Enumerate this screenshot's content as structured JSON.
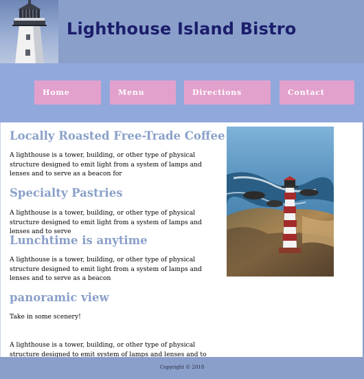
{
  "header": {
    "title": "Lighthouse Island Bistro",
    "logo_icon": "lighthouse-tower-icon"
  },
  "nav": {
    "items": [
      {
        "label": "Home"
      },
      {
        "label": "Menu"
      },
      {
        "label": "Directions"
      },
      {
        "label": "Contact"
      }
    ]
  },
  "main": {
    "sections": [
      {
        "heading": "Locally Roasted Free-Trade Coffee",
        "text": "A lighthouse is a tower, building, or other type of physical structure designed to emit light from a system of lamps and lenses and to serve as a beacon for"
      },
      {
        "heading": "Specialty Pastries",
        "text": "A lighthouse is a tower, building, or other type of physical structure designed to emit light from a system of lamps and lenses and to serve"
      },
      {
        "heading": "Lunchtime is anytime",
        "text": "A lighthouse is a tower, building, or other type of physical structure designed to emit light from a system of lamps and lenses and to serve as a beacon"
      },
      {
        "heading": "panoramic view",
        "intro": "Take in some scenery!",
        "text": "A lighthouse is a tower, building, or other type of physical structure designed to emit system of lamps and lenses and to serve as a beacon"
      }
    ],
    "photo_icon": "lighthouse-coast-photo"
  },
  "footer": {
    "copyright": "Copyright © 2018"
  },
  "colors": {
    "header_bg": "#8a9fca",
    "nav_bg": "#90a8dc",
    "nav_button": "#e2a1cc",
    "title": "#1b1d6b",
    "heading": "#8aa0c9"
  }
}
